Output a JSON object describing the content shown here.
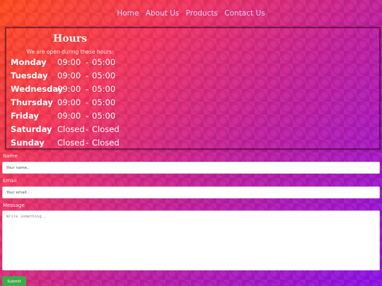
{
  "nav": {
    "items": [
      "Home",
      "About Us",
      "Products",
      "Contact Us"
    ]
  },
  "hours": {
    "title": "Hours",
    "subtitle": "We are open during these hours:",
    "rows": [
      {
        "day": "Monday",
        "open": "09:00",
        "dash": "-",
        "close": "05:00"
      },
      {
        "day": "Tuesday",
        "open": "09:00",
        "dash": "-",
        "close": "05:00"
      },
      {
        "day": "Wednesday",
        "open": "09:00",
        "dash": "-",
        "close": "05:00"
      },
      {
        "day": "Thursday",
        "open": "09:00",
        "dash": "-",
        "close": "05:00"
      },
      {
        "day": "Friday",
        "open": "09:00",
        "dash": "-",
        "close": "05:00"
      },
      {
        "day": "Saturday",
        "open": "Closed",
        "dash": "-",
        "close": "Closed"
      },
      {
        "day": "Sunday",
        "open": "Closed",
        "dash": "-",
        "close": "Closed"
      }
    ]
  },
  "form": {
    "name_label": "Name",
    "name_placeholder": "Your name..",
    "email_label": "Email",
    "email_placeholder": "Your email..",
    "message_label": "Message",
    "message_placeholder": "Write something..",
    "submit_label": "Submit"
  },
  "colors": {
    "gradient_start": "#ff4a1c",
    "gradient_end": "#8a10e6",
    "submit_green": "#3cab48",
    "nav_link": "#d8d0ff"
  }
}
